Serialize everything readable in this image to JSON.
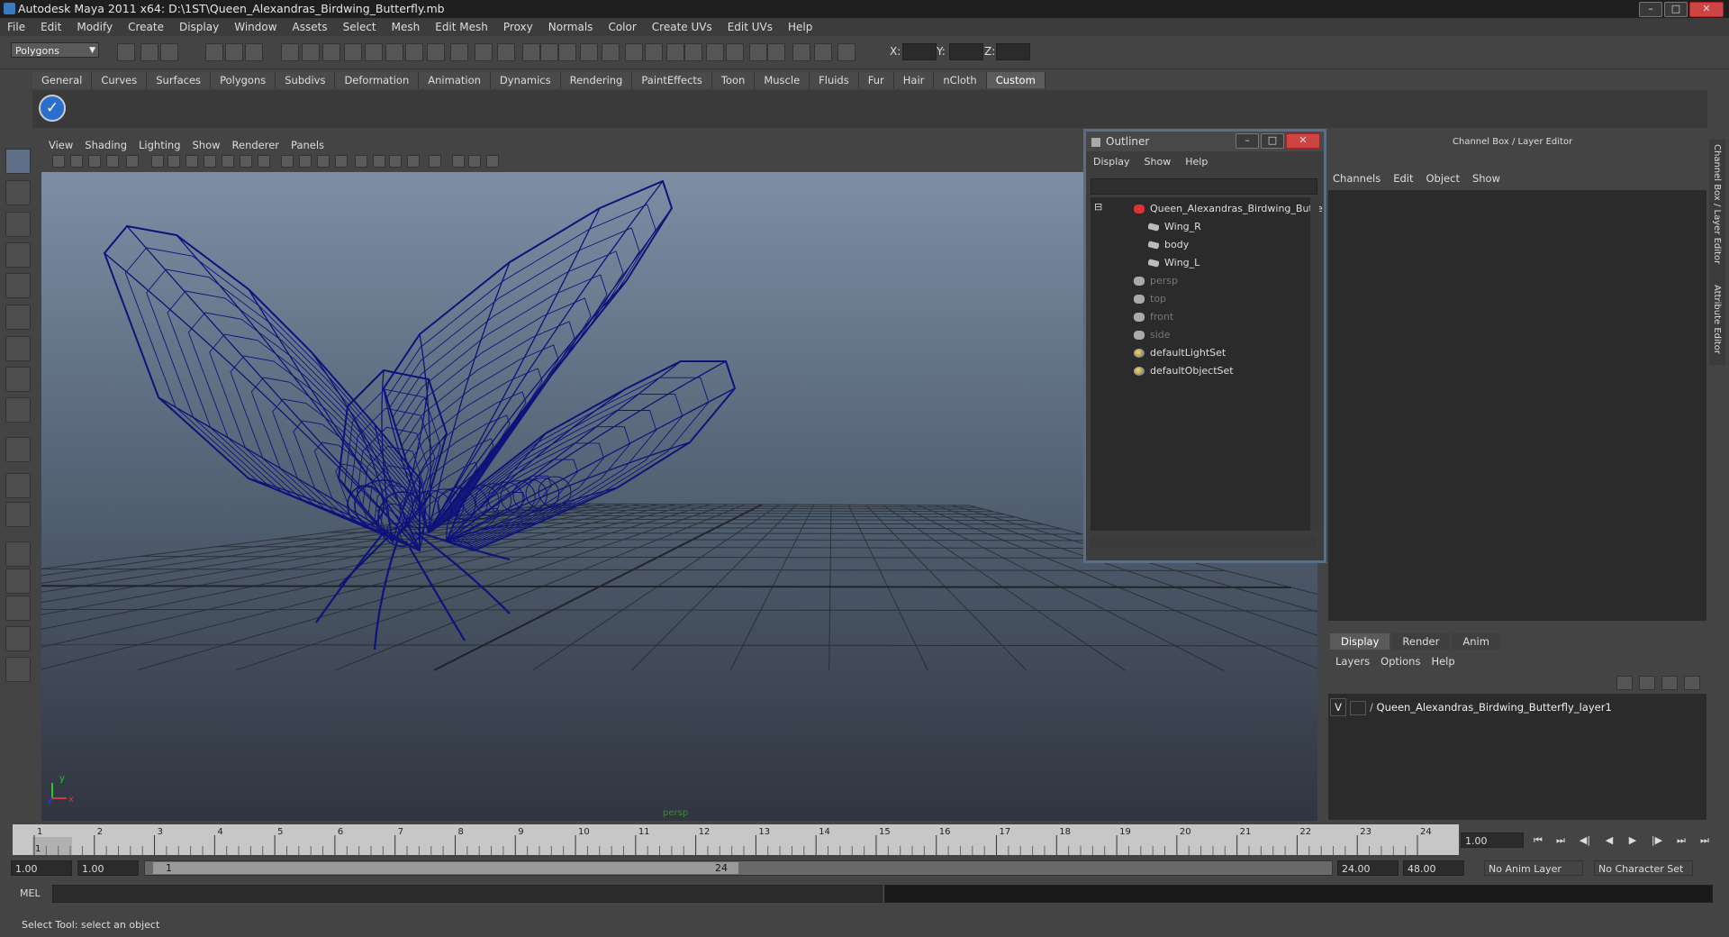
{
  "window": {
    "title": "Autodesk Maya 2011 x64: D:\\1ST\\Queen_Alexandras_Birdwing_Butterfly.mb"
  },
  "menubar": [
    "File",
    "Edit",
    "Modify",
    "Create",
    "Display",
    "Window",
    "Assets",
    "Select",
    "Mesh",
    "Edit Mesh",
    "Proxy",
    "Normals",
    "Color",
    "Create UVs",
    "Edit UVs",
    "Help"
  ],
  "statusline": {
    "mode": "Polygons",
    "x_label": "X:",
    "y_label": "Y:",
    "z_label": "Z:"
  },
  "shelf": {
    "tabs": [
      "General",
      "Curves",
      "Surfaces",
      "Polygons",
      "Subdivs",
      "Deformation",
      "Animation",
      "Dynamics",
      "Rendering",
      "PaintEffects",
      "Toon",
      "Muscle",
      "Fluids",
      "Fur",
      "Hair",
      "nCloth",
      "Custom"
    ],
    "active": "Custom"
  },
  "viewport": {
    "menu": [
      "View",
      "Shading",
      "Lighting",
      "Show",
      "Renderer",
      "Panels"
    ],
    "camera_label": "persp",
    "axis_x": "x",
    "axis_y": "y",
    "wire_color": "#0d137a"
  },
  "outliner": {
    "title": "Outliner",
    "menu": [
      "Display",
      "Show",
      "Help"
    ],
    "items": [
      {
        "label": "Queen_Alexandras_Birdwing_Butte",
        "type": "grp",
        "dim": false
      },
      {
        "label": "Wing_R",
        "type": "mesh",
        "dim": false
      },
      {
        "label": "body",
        "type": "mesh",
        "dim": false
      },
      {
        "label": "Wing_L",
        "type": "mesh",
        "dim": false
      },
      {
        "label": "persp",
        "type": "cam",
        "dim": true
      },
      {
        "label": "top",
        "type": "cam",
        "dim": true
      },
      {
        "label": "front",
        "type": "cam",
        "dim": true
      },
      {
        "label": "side",
        "type": "cam",
        "dim": true
      },
      {
        "label": "defaultLightSet",
        "type": "set",
        "dim": false
      },
      {
        "label": "defaultObjectSet",
        "type": "set",
        "dim": false
      }
    ]
  },
  "channelbox": {
    "header": "Channel Box / Layer Editor",
    "menu": [
      "Channels",
      "Edit",
      "Object",
      "Show"
    ],
    "side_tabs": [
      "Channel Box / Layer Editor",
      "Attribute Editor"
    ]
  },
  "layereditor": {
    "tabs": [
      "Display",
      "Render",
      "Anim"
    ],
    "active": "Display",
    "menu": [
      "Layers",
      "Options",
      "Help"
    ],
    "layer": {
      "visible": "V",
      "name": "Queen_Alexandras_Birdwing_Butterfly_layer1"
    }
  },
  "timeslider": {
    "ticks": [
      "1",
      "2",
      "3",
      "4",
      "5",
      "6",
      "7",
      "8",
      "9",
      "10",
      "11",
      "12",
      "13",
      "14",
      "15",
      "16",
      "17",
      "18",
      "19",
      "20",
      "21",
      "22",
      "23",
      "24"
    ],
    "current_marker": "1",
    "current_frame": "1.00"
  },
  "range": {
    "start": "1.00",
    "inner_start": "1.00",
    "range_start_label": "1",
    "range_end_label": "24",
    "end": "24.00",
    "anim_end": "48.00",
    "anim_layer": "No Anim Layer",
    "character_set": "No Character Set"
  },
  "commandline": {
    "label": "MEL"
  },
  "helpline": {
    "text": "Select Tool: select an object"
  }
}
